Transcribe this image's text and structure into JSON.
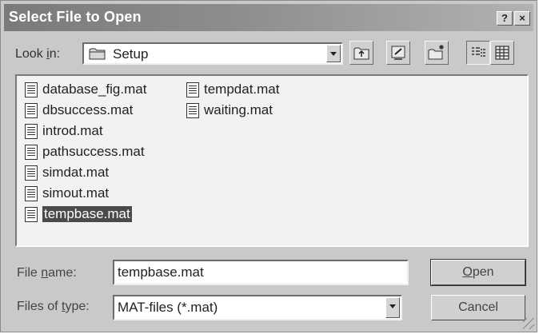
{
  "window": {
    "title": "Select File to Open"
  },
  "title_buttons": {
    "help": "?",
    "close": "×"
  },
  "look_in": {
    "label_prefix": "Look ",
    "label_accel": "i",
    "label_suffix": "n:",
    "value": "Setup"
  },
  "toolbar": {
    "up_icon": "up-one-level-icon",
    "desktop_icon": "desktop-icon",
    "new_folder_icon": "new-folder-icon",
    "list_view_icon": "list-view-icon",
    "details_view_icon": "details-view-icon"
  },
  "files": {
    "column1": [
      "database_fig.mat",
      "dbsuccess.mat",
      "introd.mat",
      "pathsuccess.mat",
      "simdat.mat",
      "simout.mat",
      "tempbase.mat"
    ],
    "column2": [
      "tempdat.mat",
      "waiting.mat"
    ],
    "selected": "tempbase.mat"
  },
  "filename": {
    "label_prefix": "File ",
    "label_accel": "n",
    "label_suffix": "ame:",
    "value": "tempbase.mat"
  },
  "filetype": {
    "label_prefix": "Files of ",
    "label_accel": "t",
    "label_suffix": "ype:",
    "value": "MAT-files (*.mat)"
  },
  "buttons": {
    "open_accel": "O",
    "open_rest": "pen",
    "cancel": "Cancel"
  },
  "colors": {
    "titlebar": "#8e8e8e",
    "selection": "#4a4a4a",
    "face": "#c9c9c9"
  }
}
